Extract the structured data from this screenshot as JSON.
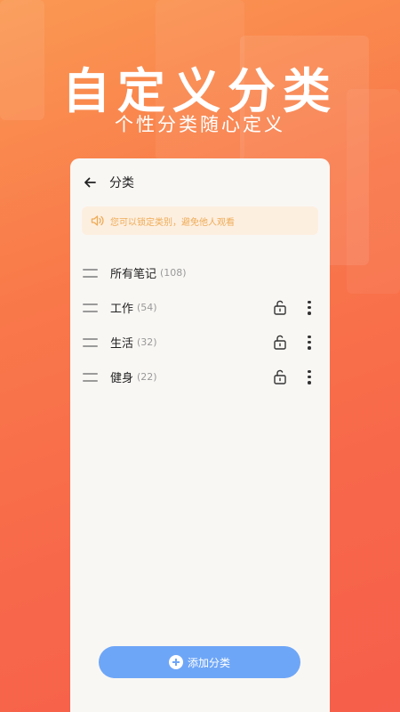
{
  "hero": {
    "title": "自定义分类",
    "subtitle": "个性分类随心定义"
  },
  "header": {
    "title": "分类",
    "back_icon": "arrow-left-icon"
  },
  "notice": {
    "icon": "speaker-icon",
    "text": "您可以锁定类别，避免他人观看",
    "color": "#eeab56"
  },
  "categories": [
    {
      "name": "所有笔记",
      "count": "(108)",
      "locked": false
    },
    {
      "name": "工作",
      "count": "(54)",
      "locked": true
    },
    {
      "name": "生活",
      "count": "(32)",
      "locked": true
    },
    {
      "name": "健身",
      "count": "(22)",
      "locked": true
    }
  ],
  "add_button": {
    "label": "添加分类",
    "color": "#6ea6f7"
  }
}
